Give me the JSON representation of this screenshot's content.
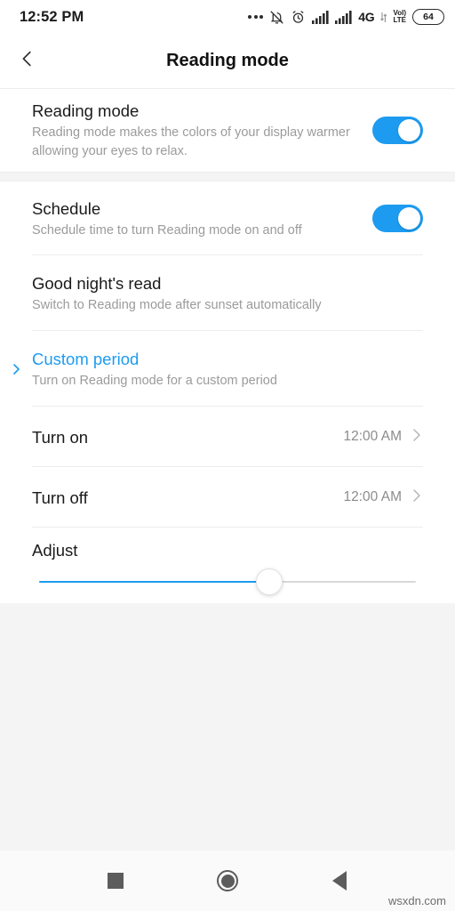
{
  "status_bar": {
    "time": "12:52 PM",
    "icons": [
      "more-dots-icon",
      "notifications-muted-icon",
      "alarm-clock-icon",
      "signal-bars-icon",
      "signal-bars-icon"
    ],
    "network_type": "4G",
    "volte_line1": "VoI)",
    "volte_line2": "LTE",
    "battery_level": "64"
  },
  "header": {
    "back_icon": "chevron-left-icon",
    "title": "Reading mode"
  },
  "sections": [
    {
      "rows": [
        {
          "name": "reading-mode",
          "title": "Reading mode",
          "subtitle": "Reading mode makes the colors of your display warmer allowing your eyes to relax.",
          "control": "toggle",
          "toggle_on": true
        }
      ]
    },
    {
      "rows": [
        {
          "name": "schedule",
          "title": "Schedule",
          "subtitle": "Schedule time to turn Reading mode on and off",
          "control": "toggle",
          "toggle_on": true
        },
        {
          "name": "good-nights-read",
          "title": "Good night's read",
          "subtitle": "Switch to Reading mode after sunset automatically",
          "control": "none"
        },
        {
          "name": "custom-period",
          "title": "Custom period",
          "subtitle": "Turn on Reading mode for a custom period",
          "control": "none",
          "selected": true,
          "marker_icon": "chevron-right-icon"
        },
        {
          "name": "turn-on",
          "title": "Turn on",
          "value": "12:00 AM",
          "control": "value-chevron",
          "chevron_icon": "chevron-right-icon"
        },
        {
          "name": "turn-off",
          "title": "Turn off",
          "value": "12:00 AM",
          "control": "value-chevron",
          "chevron_icon": "chevron-right-icon"
        }
      ],
      "slider": {
        "name": "adjust",
        "label": "Adjust",
        "value_percent": 61
      }
    }
  ],
  "navbar": {
    "recents_icon": "square-recents-icon",
    "home_icon": "circle-home-icon",
    "back_icon": "triangle-back-icon",
    "watermark": "wsxdn.com"
  },
  "colors": {
    "accent": "#1d9bf0",
    "card": "#ffffff",
    "background": "#f4f4f4"
  }
}
